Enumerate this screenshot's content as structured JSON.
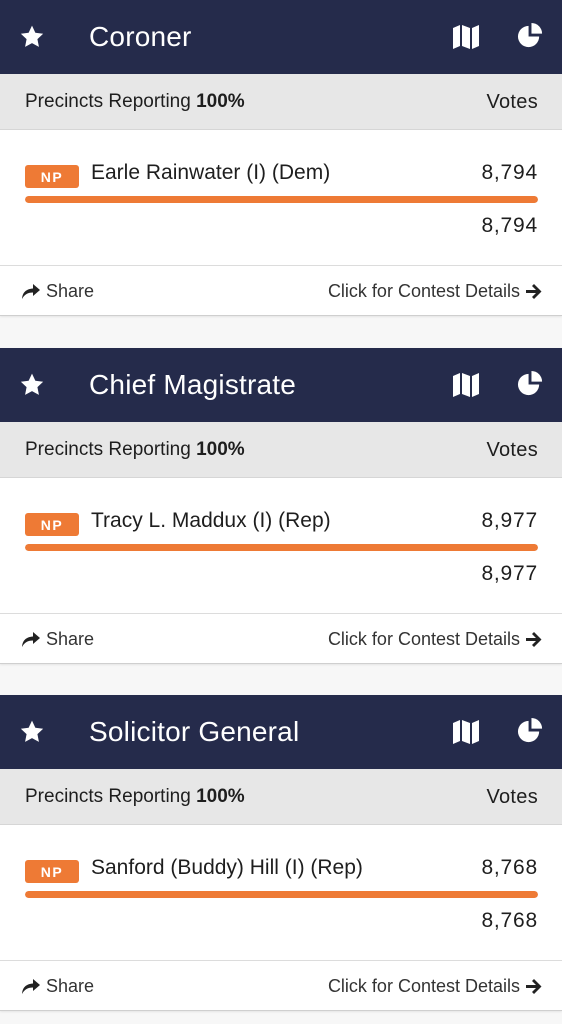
{
  "labels": {
    "precincts_prefix": "Precincts Reporting",
    "votes_header": "Votes",
    "share": "Share",
    "details": "Click for Contest Details"
  },
  "colors": {
    "header": "#252b4b",
    "accent": "#ee7a35"
  },
  "icons": [
    "star-icon",
    "map-icon",
    "pie-chart-icon",
    "share-icon",
    "arrow-right-icon"
  ],
  "contests": [
    {
      "title": "Coroner",
      "precincts": "100%",
      "candidate": {
        "party_badge": "NP",
        "name": "Earle Rainwater (I) (Dem)",
        "votes": "8,794",
        "share_percent": 100
      },
      "total_votes": "8,794"
    },
    {
      "title": "Chief Magistrate",
      "precincts": "100%",
      "candidate": {
        "party_badge": "NP",
        "name": "Tracy L. Maddux (I) (Rep)",
        "votes": "8,977",
        "share_percent": 100
      },
      "total_votes": "8,977"
    },
    {
      "title": "Solicitor General",
      "precincts": "100%",
      "candidate": {
        "party_badge": "NP",
        "name": "Sanford (Buddy) Hill (I) (Rep)",
        "votes": "8,768",
        "share_percent": 100
      },
      "total_votes": "8,768"
    }
  ]
}
